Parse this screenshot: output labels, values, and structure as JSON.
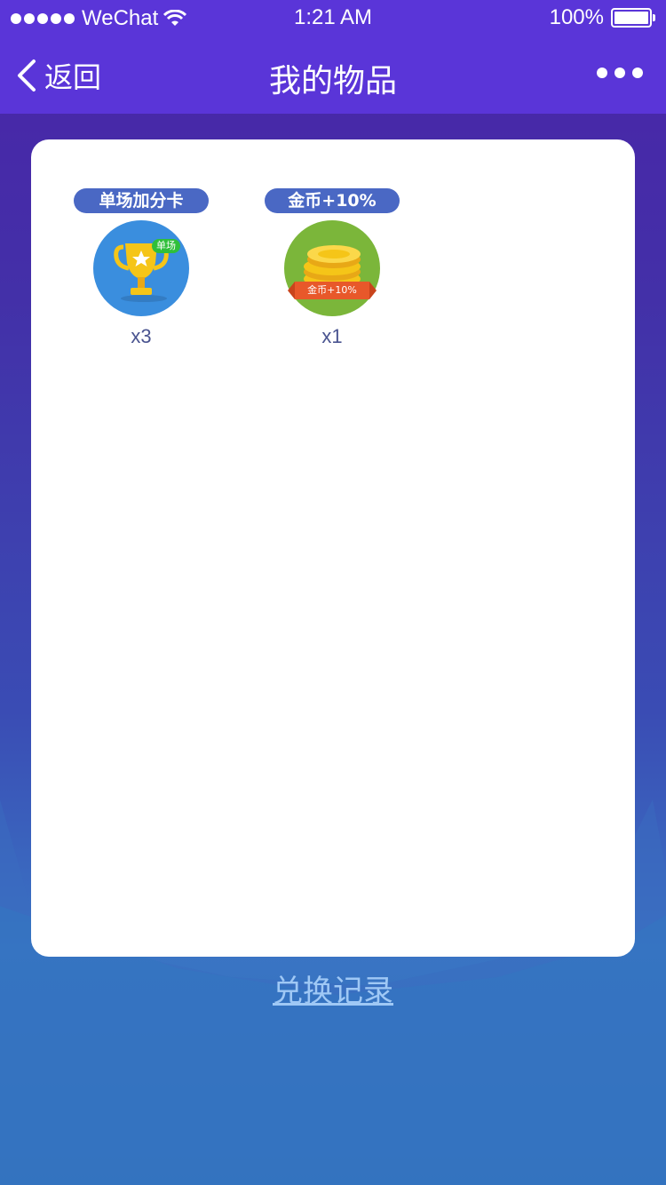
{
  "status_bar": {
    "carrier": "WeChat",
    "time": "1:21 AM",
    "battery": "100%"
  },
  "nav": {
    "back_label": "返回",
    "title": "我的物品"
  },
  "items": [
    {
      "tag": "单场加分卡",
      "badge": "单场",
      "count": "x3",
      "icon": "trophy-icon",
      "icon_bg": "#3a8ede"
    },
    {
      "tag": "金币+10%",
      "badge": "金币+10%",
      "count": "x1",
      "icon": "gold-coins-icon",
      "icon_bg": "#7bb63a"
    }
  ],
  "footer": {
    "exchange_link": "兑换记录"
  },
  "colors": {
    "header": "#5a35d8",
    "tag": "#4a68c4",
    "link": "#9fc8f5"
  }
}
